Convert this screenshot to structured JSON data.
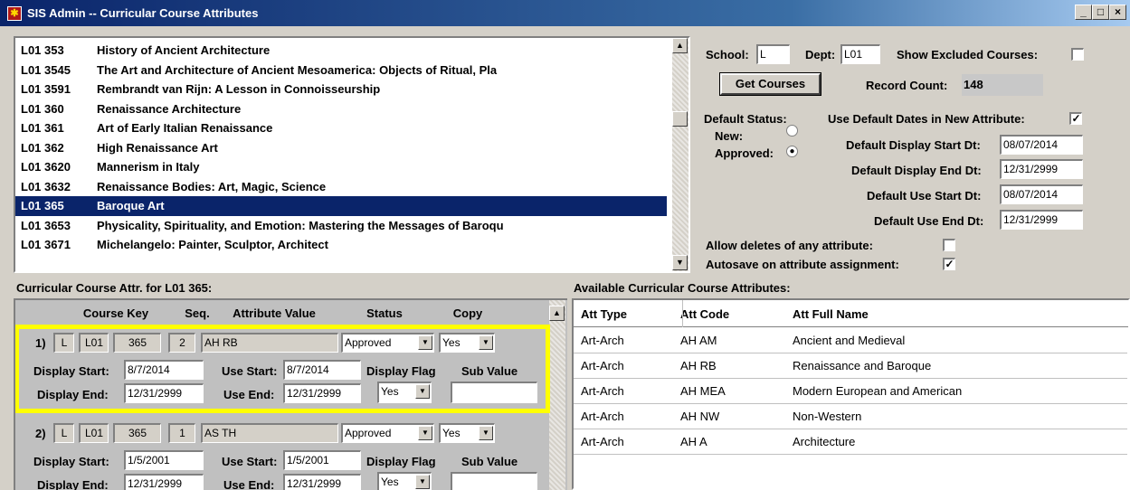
{
  "window": {
    "title": "SIS Admin -- Curricular Course Attributes",
    "minimize_glyph": "_",
    "restore_glyph": "□",
    "close_glyph": "×"
  },
  "courses": [
    {
      "code": "L01 353",
      "title": "History of Ancient Architecture"
    },
    {
      "code": "L01 3545",
      "title": "The Art and Architecture of Ancient Mesoamerica: Objects of Ritual, Pla"
    },
    {
      "code": "L01 3591",
      "title": "Rembrandt van Rijn:  A Lesson in Connoisseurship"
    },
    {
      "code": "L01 360",
      "title": "Renaissance Architecture"
    },
    {
      "code": "L01 361",
      "title": "Art of Early Italian Renaissance"
    },
    {
      "code": "L01 362",
      "title": "High Renaissance Art"
    },
    {
      "code": "L01 3620",
      "title": "Mannerism in Italy"
    },
    {
      "code": "L01 3632",
      "title": "Renaissance Bodies: Art, Magic, Science"
    },
    {
      "code": "L01 365",
      "title": "Baroque Art",
      "selected": true
    },
    {
      "code": "L01 3653",
      "title": "Physicality, Spirituality, and Emotion: Mastering the Messages of Baroqu"
    },
    {
      "code": "L01 3671",
      "title": "Michelangelo: Painter, Sculptor, Architect"
    }
  ],
  "filters": {
    "school_label": "School:",
    "school_value": "L",
    "dept_label": "Dept:",
    "dept_value": "L01",
    "show_excluded_label": "Show Excluded Courses:",
    "show_excluded_checked": false,
    "get_courses_label": "Get Courses",
    "record_count_label": "Record Count:",
    "record_count_value": "148"
  },
  "defaults": {
    "status_label": "Default Status:",
    "new_label": "New:",
    "approved_label": "Approved:",
    "selected_status": "Approved",
    "use_default_dates_label": "Use Default Dates in New Attribute:",
    "use_default_dates_checked": true,
    "display_start_label": "Default Display Start Dt:",
    "display_start_value": "08/07/2014",
    "display_end_label": "Default Display End Dt:",
    "display_end_value": "12/31/2999",
    "use_start_label": "Default Use Start Dt:",
    "use_start_value": "08/07/2014",
    "use_end_label": "Default Use End Dt:",
    "use_end_value": "12/31/2999",
    "allow_deletes_label": "Allow deletes of any attribute:",
    "allow_deletes_checked": false,
    "autosave_label": "Autosave on attribute assignment:",
    "autosave_checked": true
  },
  "assigned": {
    "section_title": "Curricular Course Attr. for L01 365:",
    "headers": {
      "course_key": "Course Key",
      "seq": "Seq.",
      "attribute_value": "Attribute Value",
      "status": "Status",
      "copy": "Copy"
    },
    "labels": {
      "display_start": "Display Start:",
      "use_start": "Use Start:",
      "display_flag": "Display Flag",
      "sub_value": "Sub Value",
      "display_end": "Display End:",
      "use_end": "Use End:"
    },
    "records": [
      {
        "num": "1)",
        "school": "L",
        "dept": "L01",
        "course": "365",
        "seq": "2",
        "attribute": "AH RB",
        "status": "Approved",
        "copy": "Yes",
        "display_start": "8/7/2014",
        "use_start": "8/7/2014",
        "display_end": "12/31/2999",
        "use_end": "12/31/2999",
        "display_flag": "Yes",
        "sub_value": ""
      },
      {
        "num": "2)",
        "school": "L",
        "dept": "L01",
        "course": "365",
        "seq": "1",
        "attribute": "AS TH",
        "status": "Approved",
        "copy": "Yes",
        "display_start": "1/5/2001",
        "use_start": "1/5/2001",
        "display_end": "12/31/2999",
        "use_end": "12/31/2999",
        "display_flag": "Yes",
        "sub_value": ""
      }
    ],
    "highlight_color": "#ffff00"
  },
  "available": {
    "section_title": "Available Curricular Course Attributes:",
    "headers": {
      "type": "Att Type",
      "code": "Att Code",
      "name": "Att Full Name"
    },
    "rows": [
      {
        "type": "Art-Arch",
        "code": "AH AM",
        "name": "Ancient and Medieval"
      },
      {
        "type": "Art-Arch",
        "code": "AH RB",
        "name": "Renaissance and Baroque"
      },
      {
        "type": "Art-Arch",
        "code": "AH MEA",
        "name": "Modern European and American"
      },
      {
        "type": "Art-Arch",
        "code": "AH NW",
        "name": "Non-Western"
      },
      {
        "type": "Art-Arch",
        "code": "AH A",
        "name": "Architecture"
      }
    ]
  },
  "colors": {
    "titlebar": "#0a246a",
    "selection": "#0a246a",
    "window_bg": "#d4d0c8"
  },
  "glyphs": {
    "check": "✓",
    "radio_dot": "●",
    "arrow_down": "▼",
    "arrow_up": "▲"
  }
}
